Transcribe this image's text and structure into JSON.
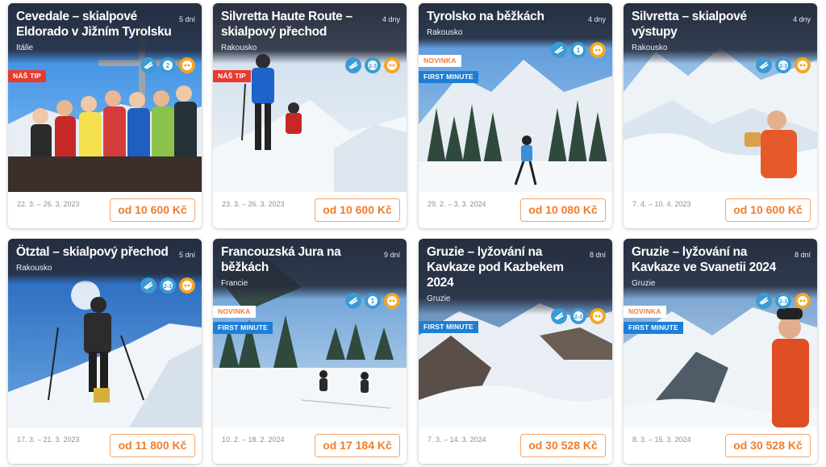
{
  "cards": [
    {
      "title": "Cevedale – skialpové Eldorado v Jižním Tyrolsku",
      "days": "5 dní",
      "country": "Itálie",
      "badge_tip": "NÁŠ TIP",
      "date": "22. 3. – 26. 3. 2023",
      "price": "od 10 600 Kč"
    },
    {
      "title": "Silvretta Haute Route – skialpový přechod",
      "days": "4 dny",
      "country": "Rakousko",
      "badge_tip": "NÁŠ TIP",
      "date": "23. 3. – 26. 3. 2023",
      "price": "od 10 600 Kč"
    },
    {
      "title": "Tyrolsko na běžkách",
      "days": "4 dny",
      "country": "Rakousko",
      "badge_new": "NOVINKA",
      "badge_fm": "FIRST MINUTE",
      "date": "29. 2. – 3. 3. 2024",
      "price": "od 10 080 Kč"
    },
    {
      "title": "Silvretta – skialpové výstupy",
      "days": "4 dny",
      "country": "Rakousko",
      "date": "7. 4. – 10. 4. 2023",
      "price": "od 10 600 Kč"
    },
    {
      "title": "Ötztal – skialpový přechod",
      "days": "5 dní",
      "country": "Rakousko",
      "date": "17. 3. – 21. 3. 2023",
      "price": "od 11 800 Kč"
    },
    {
      "title": "Francouzská Jura na běžkách",
      "days": "9 dní",
      "country": "Francie",
      "badge_new": "NOVINKA",
      "badge_fm": "FIRST MINUTE",
      "date": "10. 2. – 18. 2. 2024",
      "price": "od 17 184 Kč"
    },
    {
      "title": "Gruzie – lyžování na Kavkaze pod Kazbekem 2024",
      "days": "8 dní",
      "country": "Gruzie",
      "badge_fm": "FIRST MINUTE",
      "date": "7. 3. – 14. 3. 2024",
      "price": "od 30 528 Kč"
    },
    {
      "title": "Gruzie – lyžování na Kavkaze ve Svanetii 2024",
      "days": "8 dní",
      "country": "Gruzie",
      "badge_new": "NOVINKA",
      "badge_fm": "FIRST MINUTE",
      "date": "8. 3. – 15. 3. 2024",
      "price": "od 30 528 Kč"
    }
  ],
  "icon_names": [
    "activity-type-icon",
    "difficulty-level-icon",
    "fitness-rating-icon"
  ],
  "colors": {
    "price_orange": "#f07d2c",
    "badge_red": "#e83a2e",
    "badge_blue": "#1e7fd6",
    "header_dark": "#262c3c",
    "icon_blue": "#3a9bd5",
    "icon_orange": "#f5a623"
  }
}
